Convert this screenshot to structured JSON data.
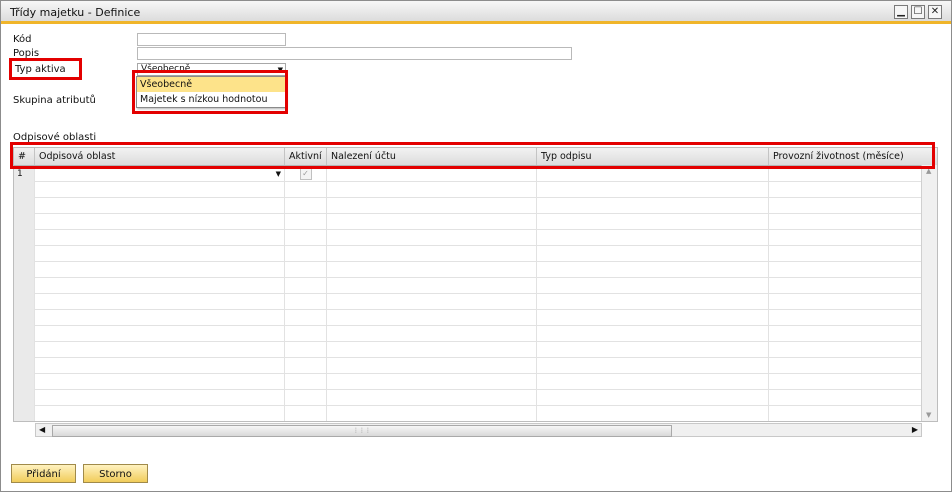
{
  "window": {
    "title": "Třídy majetku - Definice",
    "controls": {
      "minimize": "▁",
      "maximize": "☐",
      "close": "✕"
    }
  },
  "form": {
    "kod_label": "Kód",
    "kod_value": "",
    "popis_label": "Popis",
    "popis_value": "",
    "typ_aktiva_label": "Typ aktiva",
    "typ_aktiva_selected": "Všeobecně",
    "skupina_label": "Skupina atributů",
    "odpisove_oblasti_label": "Odpisové oblasti"
  },
  "dropdown": {
    "options": [
      "Všeobecně",
      "Majetek s nízkou hodnotou"
    ],
    "highlighted_index": 0
  },
  "grid": {
    "columns": [
      "#",
      "Odpisová oblast",
      "Aktivní",
      "Nalezení účtu",
      "Typ odpisu",
      "Provozní životnost (měsíce)"
    ],
    "first_row_number": "1",
    "first_row_check": "✓"
  },
  "buttons": {
    "add": "Přidání",
    "cancel": "Storno"
  },
  "colors": {
    "accent": "#f0b52a",
    "highlight_box": "#e30000",
    "dropdown_selection": "#fde38a"
  }
}
